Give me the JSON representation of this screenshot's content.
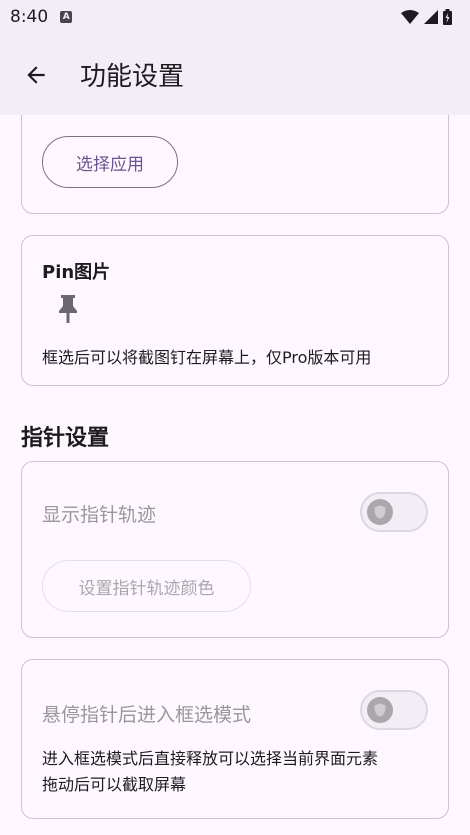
{
  "status_bar": {
    "time": "8:40",
    "notification_icon_letter": "A",
    "icons": [
      "a-notification-icon",
      "wifi-icon",
      "signal-icon",
      "battery-icon"
    ]
  },
  "app_bar": {
    "back_icon": "arrow-left-icon",
    "title": "功能设置"
  },
  "app_select_card": {
    "button_label": "选择应用"
  },
  "pin_card": {
    "title": "Pin图片",
    "icon": "pin-icon",
    "description": "框选后可以将截图钉在屏幕上，仅Pro版本可用"
  },
  "pointer_section": {
    "title": "指针设置"
  },
  "pointer_card": {
    "show_trail_label": "显示指针轨迹",
    "show_trail_enabled": false,
    "color_button_label": "设置指针轨迹颜色"
  },
  "hover_card": {
    "label": "悬停指针后进入框选模式",
    "enabled": false,
    "description_line1": "进入框选模式后直接释放可以选择当前界面元素",
    "description_line2": "拖动后可以截取屏幕"
  },
  "colors": {
    "background": "#FEF7FF",
    "app_bar": "#F3EDF7",
    "primary": "#65558F",
    "outline": "#CAC4D0",
    "disabled_text": "#9A979C"
  }
}
